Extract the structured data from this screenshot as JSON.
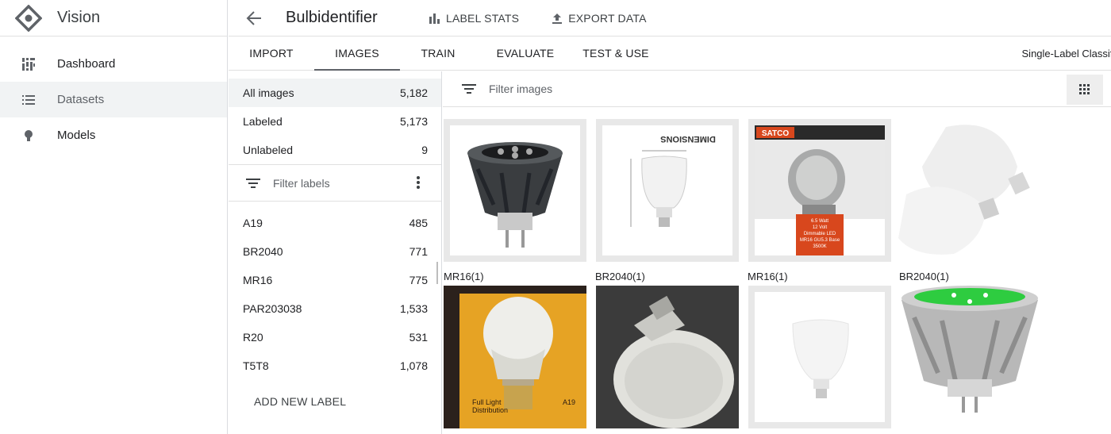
{
  "app": {
    "name": "Vision"
  },
  "nav": {
    "items": [
      {
        "label": "Dashboard",
        "icon": "dashboard-icon"
      },
      {
        "label": "Datasets",
        "icon": "list-icon"
      },
      {
        "label": "Models",
        "icon": "lightbulb-icon"
      }
    ]
  },
  "header": {
    "dataset_name": "Bulbidentifier",
    "label_stats": "LABEL STATS",
    "export_data": "EXPORT DATA"
  },
  "tabs": [
    {
      "label": "IMPORT"
    },
    {
      "label": "IMAGES"
    },
    {
      "label": "TRAIN"
    },
    {
      "label": "EVALUATE"
    },
    {
      "label": "TEST & USE"
    }
  ],
  "mode": "Single-Label Classification",
  "summary": [
    {
      "label": "All images",
      "count": "5,182"
    },
    {
      "label": "Labeled",
      "count": "5,173"
    },
    {
      "label": "Unlabeled",
      "count": "9"
    }
  ],
  "filter_labels_placeholder": "Filter labels",
  "labels": [
    {
      "label": "A19",
      "count": "485"
    },
    {
      "label": "BR2040",
      "count": "771"
    },
    {
      "label": "MR16",
      "count": "775"
    },
    {
      "label": "PAR203038",
      "count": "1,533"
    },
    {
      "label": "R20",
      "count": "531"
    },
    {
      "label": "T5T8",
      "count": "1,078"
    }
  ],
  "add_label": "ADD NEW LABEL",
  "filter_images_placeholder": "Filter images",
  "images": {
    "row1_captions": [
      "MR16(1)",
      "BR2040(1)",
      "MR16(1)",
      "BR2040(1)"
    ],
    "satco_brand": "SATCO",
    "dimensions_text": "DIMENSIONS",
    "satco_spec": [
      "6.5 Watt",
      "12 Volt",
      "Dimmable LED",
      "MR16 GU5.3 Base",
      "3500K"
    ],
    "a19_box_text": [
      "Full Light",
      "Distribution",
      "A19"
    ]
  },
  "colors": {
    "active_bg": "#f1f3f4",
    "divider": "#e0e0e0",
    "green_led": "#2ecc40",
    "satco_red": "#d8471d"
  }
}
